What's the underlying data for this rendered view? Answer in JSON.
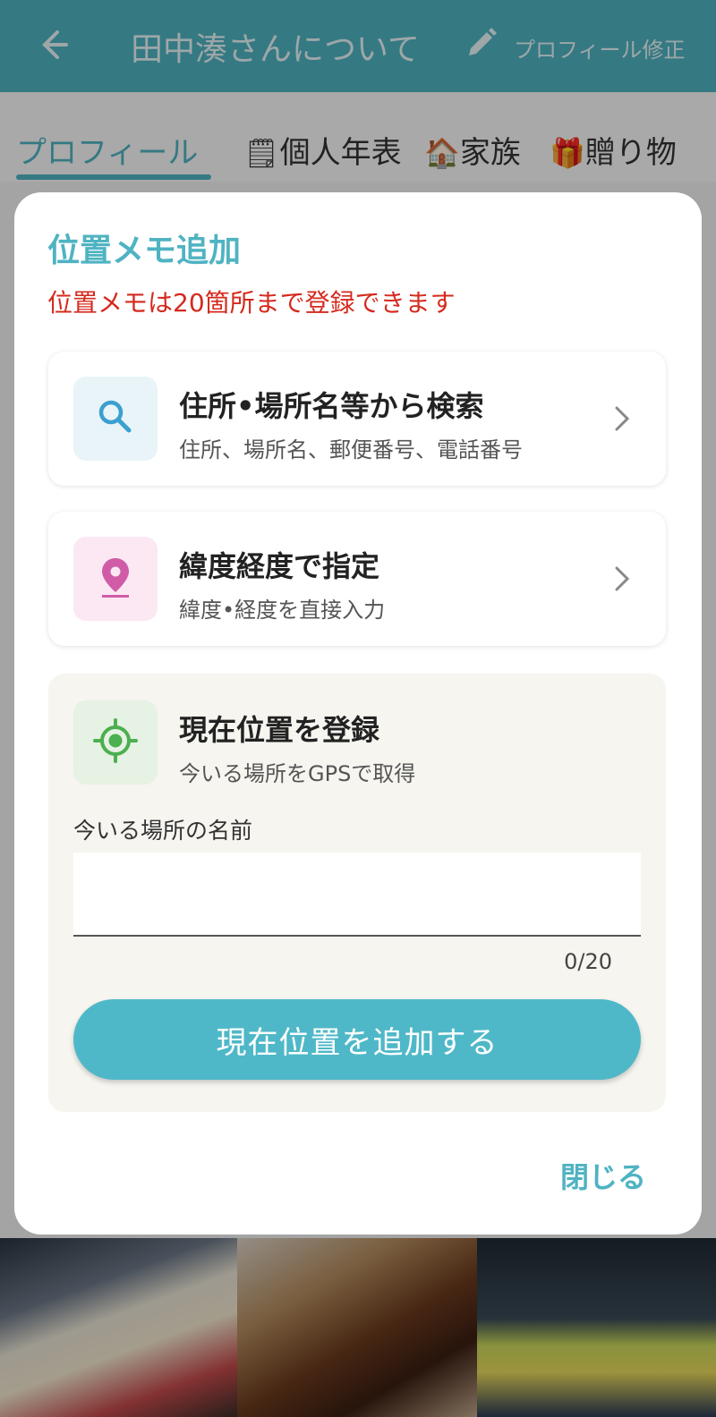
{
  "appbar": {
    "title": "田中湊さんについて",
    "edit_label": "プロフィール修正",
    "back_icon": "arrow-back-icon",
    "edit_icon": "pencil-icon"
  },
  "tabs": [
    {
      "label": "プロフィール",
      "emoji": "",
      "active": true
    },
    {
      "label": "個人年表",
      "emoji": "🗒"
    },
    {
      "label": "家族",
      "emoji": "🏠"
    },
    {
      "label": "贈り物",
      "emoji": "🎁"
    }
  ],
  "dialog": {
    "title": "位置メモ追加",
    "notice": "位置メモは20箇所まで登録できます",
    "options": {
      "search": {
        "title": "住所•場所名等から検索",
        "subtitle": "住所、場所名、郵便番号、電話番号",
        "icon": "search-icon",
        "color": "#3b9fd0"
      },
      "latlng": {
        "title": "緯度経度で指定",
        "subtitle": "緯度•経度を直接入力",
        "icon": "map-pin-icon",
        "color": "#d05ca8"
      }
    },
    "gps": {
      "title": "現在位置を登録",
      "subtitle": "今いる場所をGPSで取得",
      "icon": "gps-target-icon",
      "color": "#4caf50",
      "field_label": "今いる場所の名前",
      "field_value": "",
      "counter": "0/20",
      "add_button": "現在位置を追加する"
    },
    "close_button": "閉じる"
  },
  "colors": {
    "accent": "#4fb3c2",
    "notice": "#d42a1e"
  }
}
